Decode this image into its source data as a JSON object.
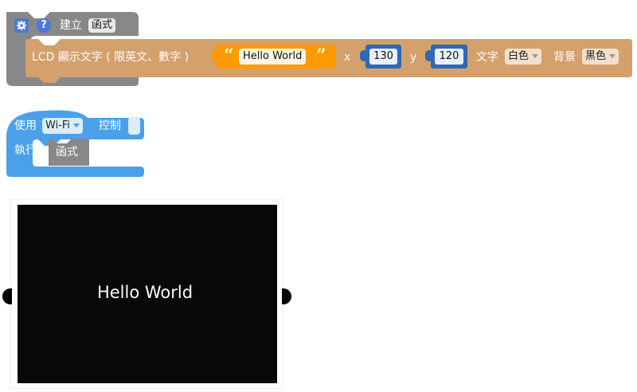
{
  "func_block": {
    "gear_icon": "gear-icon",
    "help_icon": "help-icon",
    "label": "建立",
    "field": "函式"
  },
  "lcd_block": {
    "label": "LCD 顯示文字 ( 限英文、數字 )",
    "quote_open": "“",
    "quote_close": "”",
    "text_value": "Hello World",
    "x_label": "x",
    "x_value": "130",
    "y_label": "y",
    "y_value": "120",
    "color_label": "文字",
    "color_value": "白色",
    "bg_label": "背景",
    "bg_value": "黑色"
  },
  "wifi_block": {
    "use_label": "使用",
    "wifi_value": "Wi-Fi",
    "control_label": "控制",
    "exec_label": "執行",
    "func_label": "函式"
  },
  "lcd_preview": {
    "text": "Hello World"
  },
  "colors": {
    "func_gray": "#888888",
    "lcd_brown": "#d4a06c",
    "text_orange": "#ff9a00",
    "num_blue": "#2e68b8",
    "wifi_blue": "#4aa1ea",
    "screen_black": "#080808"
  }
}
